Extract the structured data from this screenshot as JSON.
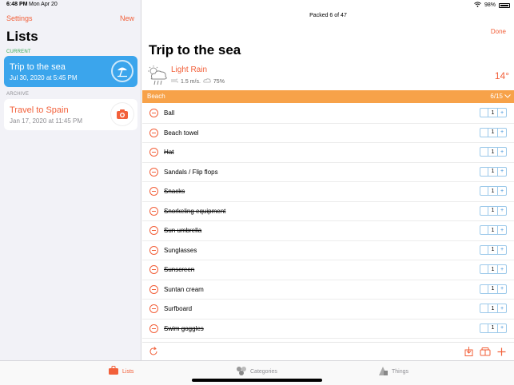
{
  "status": {
    "time": "6:48 PM",
    "date": "Mon Apr 20",
    "battery": "98%"
  },
  "sidebar": {
    "settings_label": "Settings",
    "new_label": "New",
    "title": "Lists",
    "current_label": "CURRENT",
    "archive_label": "ARCHIVE",
    "current_list": {
      "title": "Trip to the sea",
      "date": "Jul 30, 2020 at 5:45 PM",
      "icon": "beach-umbrella-icon"
    },
    "archive_list": {
      "title": "Travel to Spain",
      "date": "Jan 17, 2020 at 11:45 PM",
      "icon": "camera-icon"
    }
  },
  "main": {
    "packed_status": "Packed 6 of 47",
    "done_label": "Done",
    "title": "Trip to the sea",
    "weather": {
      "label": "Light Rain",
      "wind": "1.5 m/s.",
      "humidity": "75%",
      "temperature": "14°",
      "icon": "rain-cloud-icon"
    },
    "category": {
      "name": "Beach",
      "count": "6/15"
    },
    "items": [
      {
        "name": "Ball",
        "qty": "1",
        "packed": false
      },
      {
        "name": "Beach towel",
        "qty": "1",
        "packed": false
      },
      {
        "name": "Hat",
        "qty": "1",
        "packed": true
      },
      {
        "name": "Sandals / Flip flops",
        "qty": "1",
        "packed": false
      },
      {
        "name": "Snacks",
        "qty": "1",
        "packed": true
      },
      {
        "name": "Snorkeling equipment",
        "qty": "1",
        "packed": true
      },
      {
        "name": "Sun umbrella",
        "qty": "1",
        "packed": true
      },
      {
        "name": "Sunglasses",
        "qty": "1",
        "packed": false
      },
      {
        "name": "Sunscreen",
        "qty": "1",
        "packed": true
      },
      {
        "name": "Suntan cream",
        "qty": "1",
        "packed": false
      },
      {
        "name": "Surfboard",
        "qty": "1",
        "packed": false
      },
      {
        "name": "Swim goggles",
        "qty": "1",
        "packed": true
      }
    ],
    "stepper": {
      "minus": "",
      "plus": "+"
    }
  },
  "tabs": [
    {
      "label": "Lists",
      "icon": "suitcase-icon",
      "active": true
    },
    {
      "label": "Categories",
      "icon": "categories-icon",
      "active": false
    },
    {
      "label": "Things",
      "icon": "things-icon",
      "active": false
    }
  ],
  "colors": {
    "accent": "#f2603a",
    "current_card": "#3ba5ec",
    "category_bar": "#f7a249",
    "current_section": "#34a853"
  }
}
